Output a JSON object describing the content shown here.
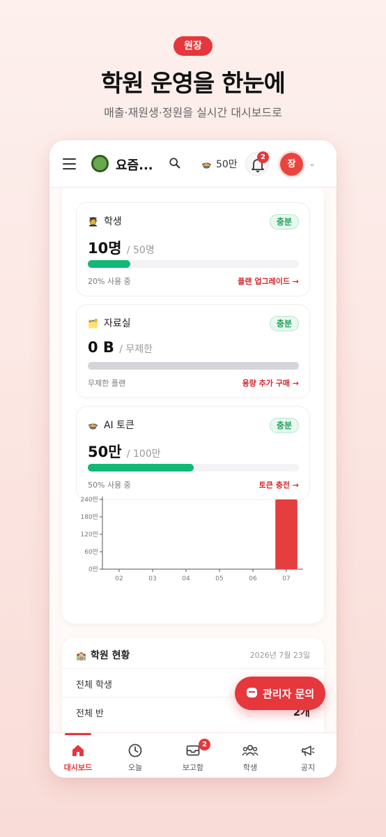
{
  "promo": {
    "badge": "원장",
    "headline": "학원 운영을 한눈에",
    "subline": "매출·재원생·정원을 실시간 대시보드로"
  },
  "appbar": {
    "app_name": "요즘...",
    "tokens": "50만",
    "notification_count": "2",
    "avatar_initial": "장"
  },
  "usage_cards": [
    {
      "emoji": "🧑‍🎓",
      "title": "학생",
      "status": "충분",
      "value": "10명",
      "limit": "/ 50명",
      "fraction": 0.2,
      "footnote": "20% 사용 중",
      "link": "플랜 업그레이드 →"
    },
    {
      "emoji": "🗂️",
      "title": "자료실",
      "status": "충분",
      "value": "0 B",
      "limit": "/ 무제한",
      "fraction": 1.0,
      "footnote": "무제한 플랜",
      "link": "용량 추가 구매 →"
    },
    {
      "emoji": "🍲",
      "title": "AI 토큰",
      "status": "충분",
      "value": "50만",
      "limit": "/ 100만",
      "fraction": 0.5,
      "footnote": "50% 사용 중",
      "link": "토큰 충전 →"
    }
  ],
  "chart_data": {
    "type": "bar",
    "categories": [
      "02",
      "03",
      "04",
      "05",
      "06",
      "07"
    ],
    "values": [
      0,
      0,
      0,
      0,
      0,
      240
    ],
    "ytick_labels": [
      "240만",
      "180만",
      "120만",
      "60만",
      "0만"
    ],
    "ylim": [
      0,
      240
    ],
    "title": "",
    "xlabel": "",
    "ylabel": "",
    "grid": false,
    "bar_color": "#e53e3e"
  },
  "academy_status": {
    "title": "학원 현황",
    "emoji": "🏫",
    "date": "2026년 7월 23일",
    "rows": [
      {
        "label": "전체 학생",
        "value": ""
      },
      {
        "label": "전체 반",
        "value": "2개"
      }
    ]
  },
  "fab": {
    "label": "관리자 문의"
  },
  "tabbar": {
    "items": [
      {
        "label": "대시보드",
        "icon": "home-icon",
        "active": true
      },
      {
        "label": "오늘",
        "icon": "clock-icon"
      },
      {
        "label": "보고함",
        "icon": "inbox-icon",
        "badge": "2"
      },
      {
        "label": "학생",
        "icon": "users-icon"
      },
      {
        "label": "공지",
        "icon": "megaphone-icon"
      }
    ]
  },
  "colors": {
    "accent": "#e5373c",
    "success": "#12b876"
  }
}
